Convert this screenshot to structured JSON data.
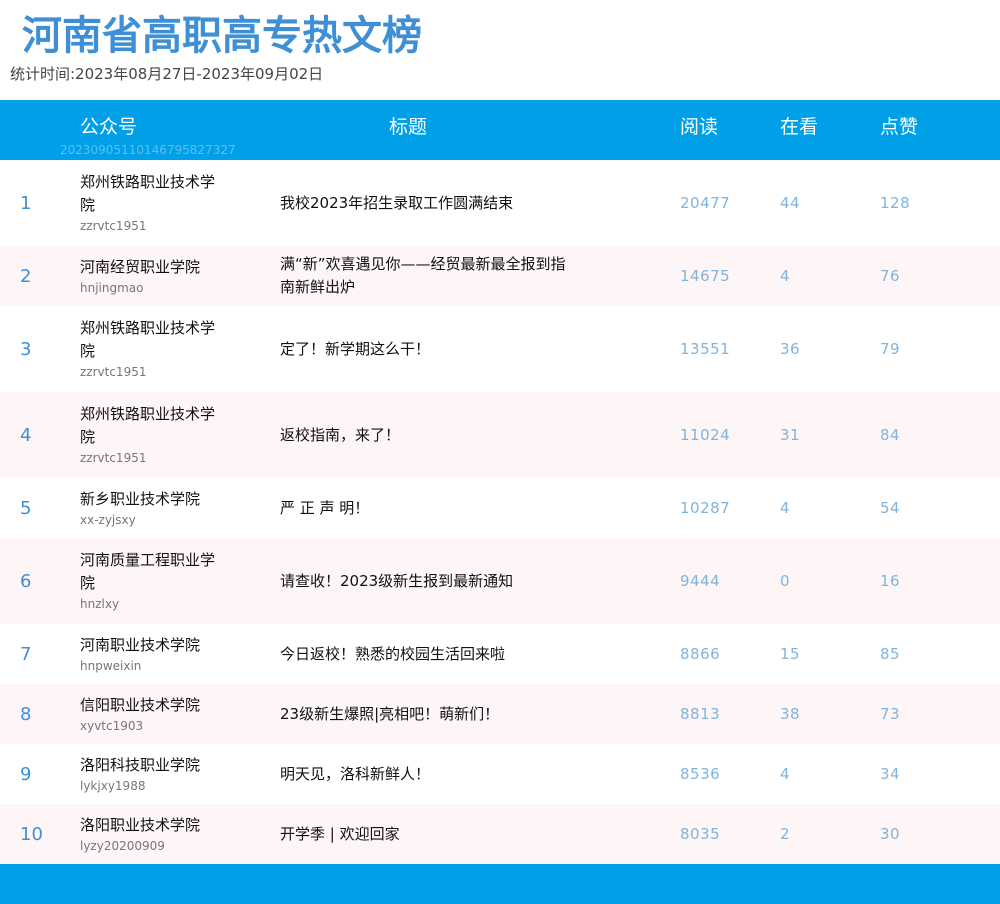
{
  "title": "河南省高职高专热文榜",
  "period": "统计时间:2023年08月27日-2023年09月02日",
  "columns": {
    "account": "公众号",
    "title": "标题",
    "read": "阅读",
    "watch": "在看",
    "like": "点赞"
  },
  "watermark": "20230905110146795827327",
  "colors": {
    "header_bar": "#00a0e9",
    "title_text": "#3e8fd6",
    "alt_row": "#fdf5f6",
    "number_text": "#7fb4de"
  },
  "rows": [
    {
      "rank": "1",
      "account": "郑州铁路职业技术学院",
      "account_id": "zzrvtc1951",
      "title": "我校2023年招生录取工作圆满结束",
      "read": "20477",
      "watch": "44",
      "like": "128"
    },
    {
      "rank": "2",
      "account": "河南经贸职业学院",
      "account_id": "hnjingmao",
      "title": "满“新”欢喜遇见你——经贸最新最全报到指南新鲜出炉",
      "read": "14675",
      "watch": "4",
      "like": "76"
    },
    {
      "rank": "3",
      "account": "郑州铁路职业技术学院",
      "account_id": "zzrvtc1951",
      "title": "定了！新学期这么干！",
      "read": "13551",
      "watch": "36",
      "like": "79"
    },
    {
      "rank": "4",
      "account": "郑州铁路职业技术学院",
      "account_id": "zzrvtc1951",
      "title": "返校指南，来了！",
      "read": "11024",
      "watch": "31",
      "like": "84"
    },
    {
      "rank": "5",
      "account": "新乡职业技术学院",
      "account_id": "xx-zyjsxy",
      "title": "严 正 声 明！",
      "read": "10287",
      "watch": "4",
      "like": "54"
    },
    {
      "rank": "6",
      "account": "河南质量工程职业学院",
      "account_id": "hnzlxy",
      "title": "请查收！2023级新生报到最新通知",
      "read": "9444",
      "watch": "0",
      "like": "16"
    },
    {
      "rank": "7",
      "account": "河南职业技术学院",
      "account_id": "hnpweixin",
      "title": "今日返校！熟悉的校园生活回来啦",
      "read": "8866",
      "watch": "15",
      "like": "85"
    },
    {
      "rank": "8",
      "account": "信阳职业技术学院",
      "account_id": "xyvtc1903",
      "title": "23级新生爆照|亮相吧！萌新们！",
      "read": "8813",
      "watch": "38",
      "like": "73"
    },
    {
      "rank": "9",
      "account": "洛阳科技职业学院",
      "account_id": "lykjxy1988",
      "title": "明天见，洛科新鲜人！",
      "read": "8536",
      "watch": "4",
      "like": "34"
    },
    {
      "rank": "10",
      "account": "洛阳职业技术学院",
      "account_id": "lyzy20200909",
      "title": "开学季 | 欢迎回家",
      "read": "8035",
      "watch": "2",
      "like": "30"
    }
  ]
}
